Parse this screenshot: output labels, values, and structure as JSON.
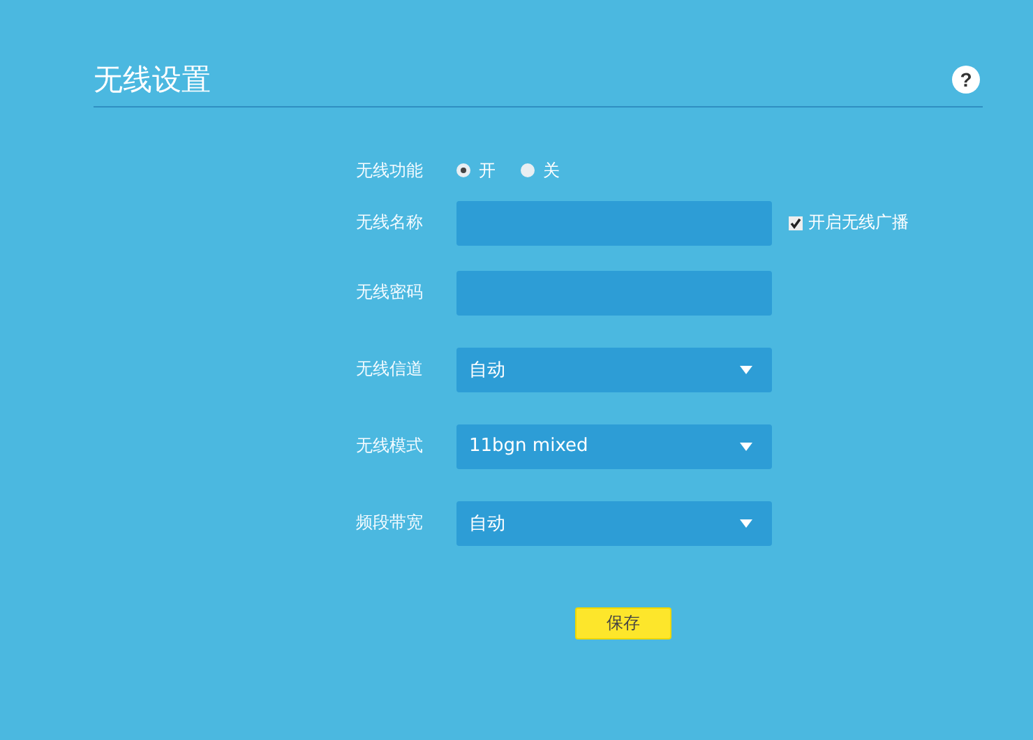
{
  "page": {
    "title": "无线设置",
    "help": "?"
  },
  "fields": [
    {
      "kind": "radio",
      "label": "无线功能",
      "options": [
        {
          "label": "开",
          "selected": true
        },
        {
          "label": "关",
          "selected": false
        }
      ]
    },
    {
      "kind": "text",
      "label": "无线名称",
      "checkbox": {
        "label": "开启无线广播",
        "checked": true
      }
    },
    {
      "kind": "text",
      "label": "无线密码"
    },
    {
      "kind": "select",
      "label": "无线信道",
      "value": "自动"
    },
    {
      "kind": "select",
      "label": "无线模式",
      "value": "11bgn mixed"
    },
    {
      "kind": "select",
      "label": "频段带宽",
      "value": "自动"
    }
  ],
  "save_button": "保存"
}
